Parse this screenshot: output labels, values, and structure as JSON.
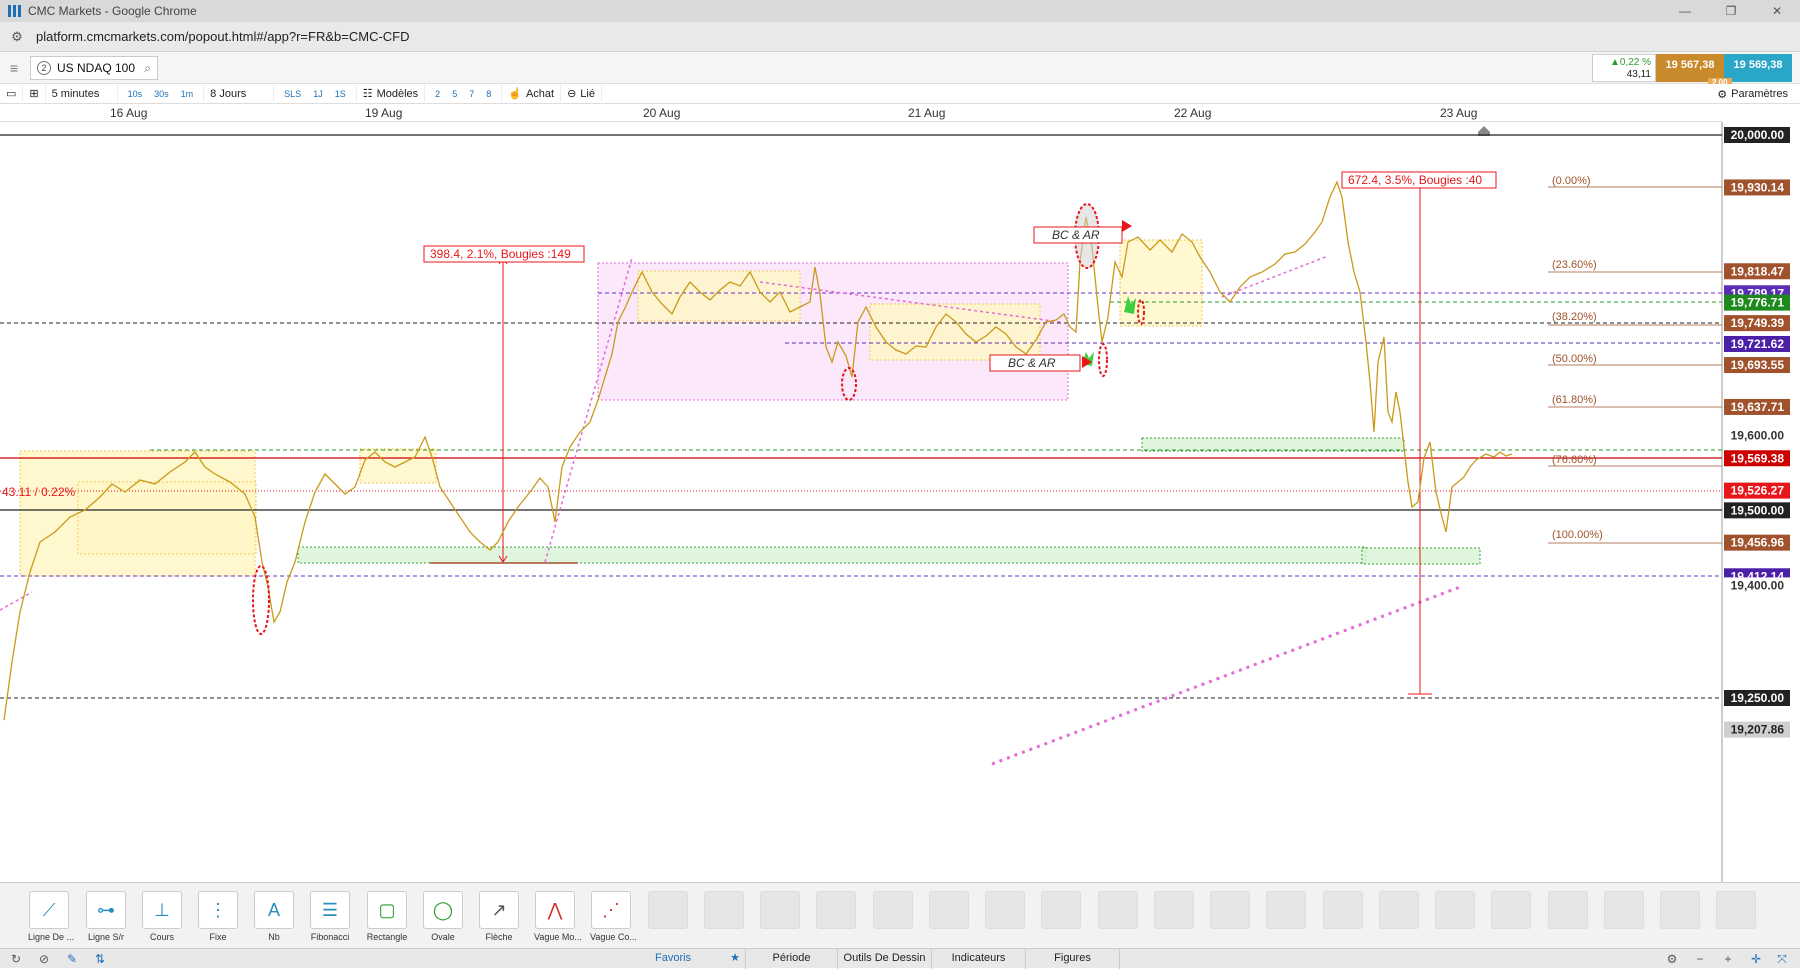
{
  "window": {
    "title": "CMC Markets - Google Chrome"
  },
  "browser": {
    "url": "platform.cmcmarkets.com/popout.html#/app?r=FR&b=CMC-CFD"
  },
  "instrument": {
    "number": "2",
    "name": "US NDAQ 100"
  },
  "prices": {
    "change_pct": "▲0,22 %",
    "change_abs": "43,11",
    "sell": "19 567,38",
    "buy": "19 569,38",
    "spread": "2.00"
  },
  "toolbar": {
    "interval": "5 minutes",
    "quick_intervals": [
      "10s",
      "30s",
      "1m"
    ],
    "period": "8 Jours",
    "modes": [
      "SLS",
      "1J",
      "1S"
    ],
    "models": "Modèles",
    "counts": [
      "2",
      "5",
      "7",
      "8"
    ],
    "achat": "Achat",
    "lie": "Lié",
    "params": "Paramètres"
  },
  "dates": [
    "16 Aug",
    "19 Aug",
    "20 Aug",
    "21 Aug",
    "22 Aug",
    "23 Aug"
  ],
  "chart": {
    "current_price": "19,569.38",
    "change_label": "43.11 / 0.22%",
    "annotations": {
      "move1": "398.4, 2.1%, Bougies :149",
      "move2": "672.4, 3.5%, Bougies :40",
      "bcar1": "BC & AR",
      "bcar2": "BC & AR"
    },
    "fib_labels": [
      "(0.00%)",
      "(23.60%)",
      "(38.20%)",
      "(50.00%)",
      "(61.80%)",
      "(76.60%)",
      "(100.00%)"
    ],
    "axis_prices": [
      {
        "label": "20,000.00",
        "color": "#222222",
        "text": "#ffffff"
      },
      {
        "label": "19,930.14",
        "color": "#a0522d",
        "text": "#ffffff"
      },
      {
        "label": "19,818.47",
        "color": "#a0522d",
        "text": "#ffffff"
      },
      {
        "label": "19,789.17",
        "color": "#5a2db5",
        "text": "#ffffff"
      },
      {
        "label": "19,776.71",
        "color": "#1e8a1e",
        "text": "#ffffff"
      },
      {
        "label": "19,749.39",
        "color": "#a0522d",
        "text": "#ffffff"
      },
      {
        "label": "19,721.62",
        "color": "#4b1fa8",
        "text": "#ffffff"
      },
      {
        "label": "19,693.55",
        "color": "#a0522d",
        "text": "#ffffff"
      },
      {
        "label": "19,637.71",
        "color": "#a0522d",
        "text": "#ffffff"
      },
      {
        "label": "19,600.00",
        "color": "#ffffff",
        "text": "#333333"
      },
      {
        "label": "19,569.38",
        "color": "#cc0000",
        "text": "#ffffff"
      },
      {
        "label": "19,526.27",
        "color": "#e8161b",
        "text": "#ffffff"
      },
      {
        "label": "19,500.00",
        "color": "#222222",
        "text": "#ffffff"
      },
      {
        "label": "19,456.96",
        "color": "#a0522d",
        "text": "#ffffff"
      },
      {
        "label": "19,412.14",
        "color": "#4b1fa8",
        "text": "#ffffff"
      },
      {
        "label": "19,400.00",
        "color": "#ffffff",
        "text": "#333333"
      },
      {
        "label": "19,250.00",
        "color": "#222222",
        "text": "#ffffff"
      },
      {
        "label": "19,207.86",
        "color": "#cfcfcf",
        "text": "#222222"
      }
    ]
  },
  "tools": [
    {
      "label": "Ligne De ...",
      "icon": "line-icon"
    },
    {
      "label": "Ligne S/r",
      "icon": "sr-line-icon"
    },
    {
      "label": "Cours",
      "icon": "price-icon"
    },
    {
      "label": "Fixe",
      "icon": "fixed-icon"
    },
    {
      "label": "Nb",
      "icon": "text-icon"
    },
    {
      "label": "Fibonacci",
      "icon": "fibonacci-icon"
    },
    {
      "label": "Rectangle",
      "icon": "rectangle-icon"
    },
    {
      "label": "Ovale",
      "icon": "oval-icon"
    },
    {
      "label": "Flèche",
      "icon": "arrow-icon"
    },
    {
      "label": "Vague Mo...",
      "icon": "wave-icon"
    },
    {
      "label": "Vague Co...",
      "icon": "corrective-wave-icon"
    }
  ],
  "footer_tabs": [
    "Favoris",
    "Période",
    "Outils De Dessin",
    "Indicateurs",
    "Figures"
  ]
}
